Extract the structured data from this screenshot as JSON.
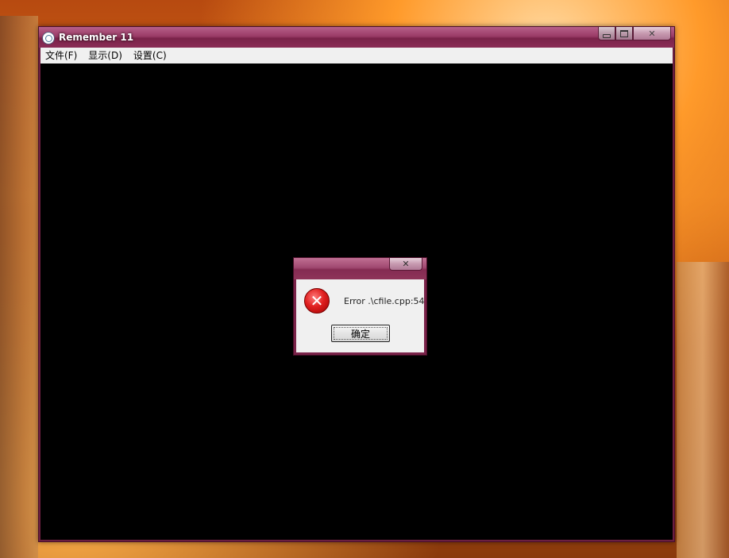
{
  "window": {
    "title": "Remember 11",
    "minimize_glyph": "",
    "maximize_glyph": "",
    "close_glyph": "✕"
  },
  "menu": {
    "items": [
      {
        "label": "文件(F)"
      },
      {
        "label": "显示(D)"
      },
      {
        "label": "设置(C)"
      }
    ]
  },
  "dialog": {
    "close_glyph": "✕",
    "icon": "error-icon",
    "icon_glyph": "✕",
    "message": "Error .\\cfile.cpp:54",
    "ok_label": "确定"
  },
  "colors": {
    "titlebar": "#8a2c56",
    "client": "#000000",
    "error": "#e02020"
  }
}
